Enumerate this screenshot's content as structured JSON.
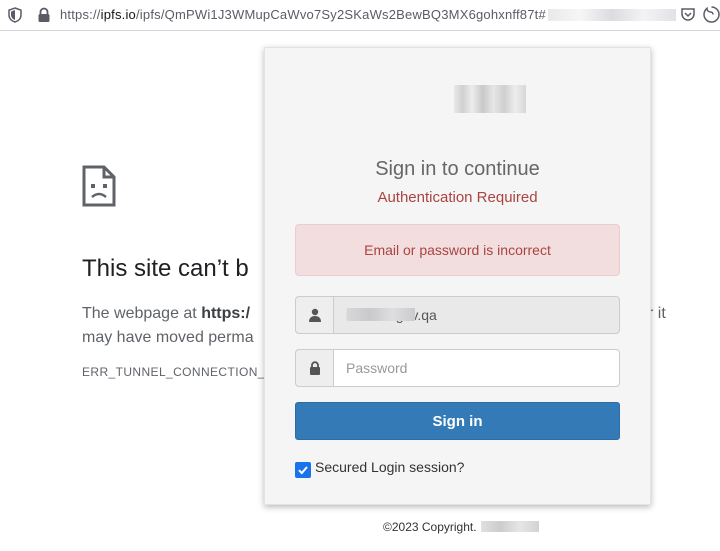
{
  "browser": {
    "url_scheme": "https://",
    "url_host": "ipfs.io",
    "url_path": "/ipfs/QmPWi1J3WMupCaWvo7Sy2SKaWs2BewBQ3MX6gohxnff87t#",
    "icons": [
      "shield-icon",
      "lock-icon",
      "pocket-icon",
      "menu-icon"
    ]
  },
  "error_page": {
    "icon": "sad-document-icon",
    "title": "This site can’t b",
    "body_prefix": "The webpage at ",
    "body_bold": "https:/",
    "body_tail": "r it",
    "body_line2": "may have moved perma",
    "code": "ERR_TUNNEL_CONNECTION_FA"
  },
  "login": {
    "heading": "Sign in to continue",
    "subheading": "Authentication Required",
    "alert": "Email or password is incorrect",
    "email_value_prefix": "i",
    "email_value_suffix": ".gov.qa",
    "password_placeholder": "Password",
    "signin_label": "Sign in",
    "remember_label": "Secured Login session?",
    "remember_checked": true,
    "colors": {
      "primary": "#337ab7",
      "alert_bg": "#f2dede",
      "alert_text": "#a94442"
    }
  },
  "footer": {
    "copyright": "©2023 Copyright."
  }
}
